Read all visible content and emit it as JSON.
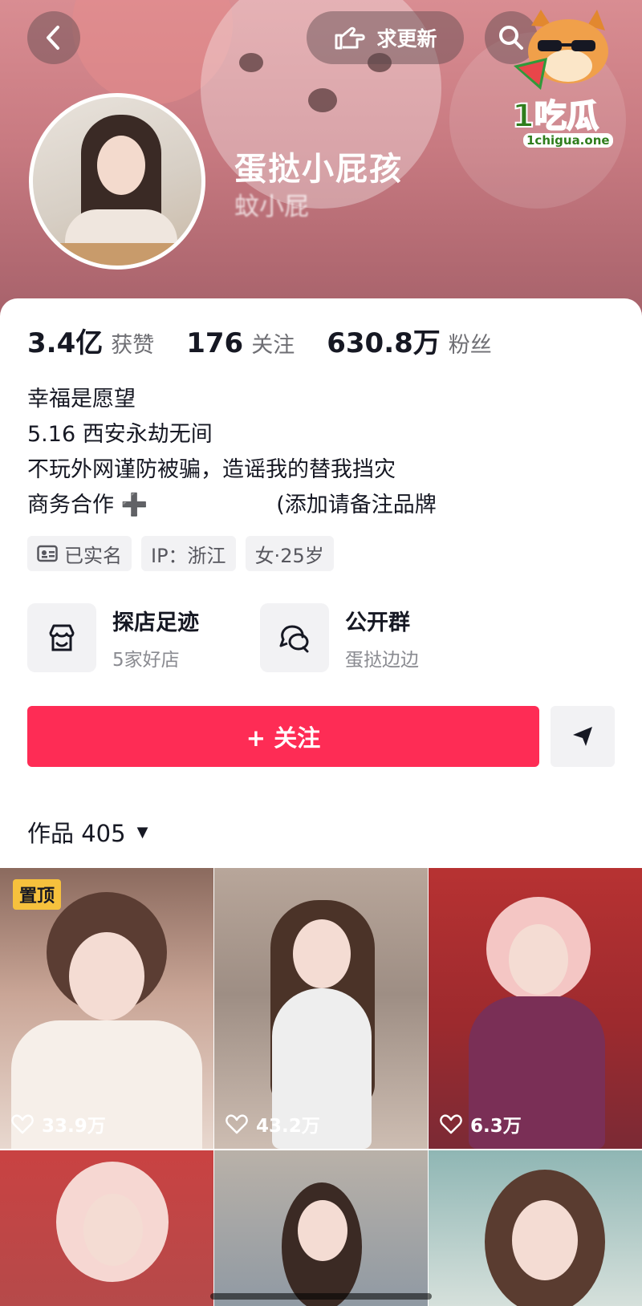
{
  "header": {
    "request_update_label": "求更新",
    "nickname": "蛋挞小屁孩",
    "douyin_id": "蚊小屁",
    "logo_cn": "1吃瓜",
    "logo_en": "1chigua.one"
  },
  "stats": [
    {
      "num": "3.4亿",
      "label": "获赞"
    },
    {
      "num": "176",
      "label": "关注"
    },
    {
      "num": "630.8万",
      "label": "粉丝"
    }
  ],
  "bio": {
    "line1": "幸福是愿望",
    "line2": "5.16 西安永劫无间",
    "line3": "不玩外网谨防被骗，造谣我的替我挡灾",
    "line4_start": "商务合作",
    "line4_plus": "➕",
    "line4_end": "(添加请备注品牌"
  },
  "tags": {
    "verified": "已实名",
    "ip": "IP：浙江",
    "gender_age": "女·25岁"
  },
  "features": {
    "shop_title": "探店足迹",
    "shop_sub": "5家好店",
    "group_title": "公开群",
    "group_sub": "蛋挞边边"
  },
  "actions": {
    "follow_label": "+ 关注"
  },
  "works": {
    "label": "作品 405",
    "caret": "▼"
  },
  "videos": [
    {
      "likes": "33.9万",
      "pinned_label": "置顶"
    },
    {
      "likes": "43.2万"
    },
    {
      "likes": "6.3万"
    }
  ],
  "colors": {
    "accent": "#fe2c55",
    "pin_badge": "#f6c13d"
  }
}
